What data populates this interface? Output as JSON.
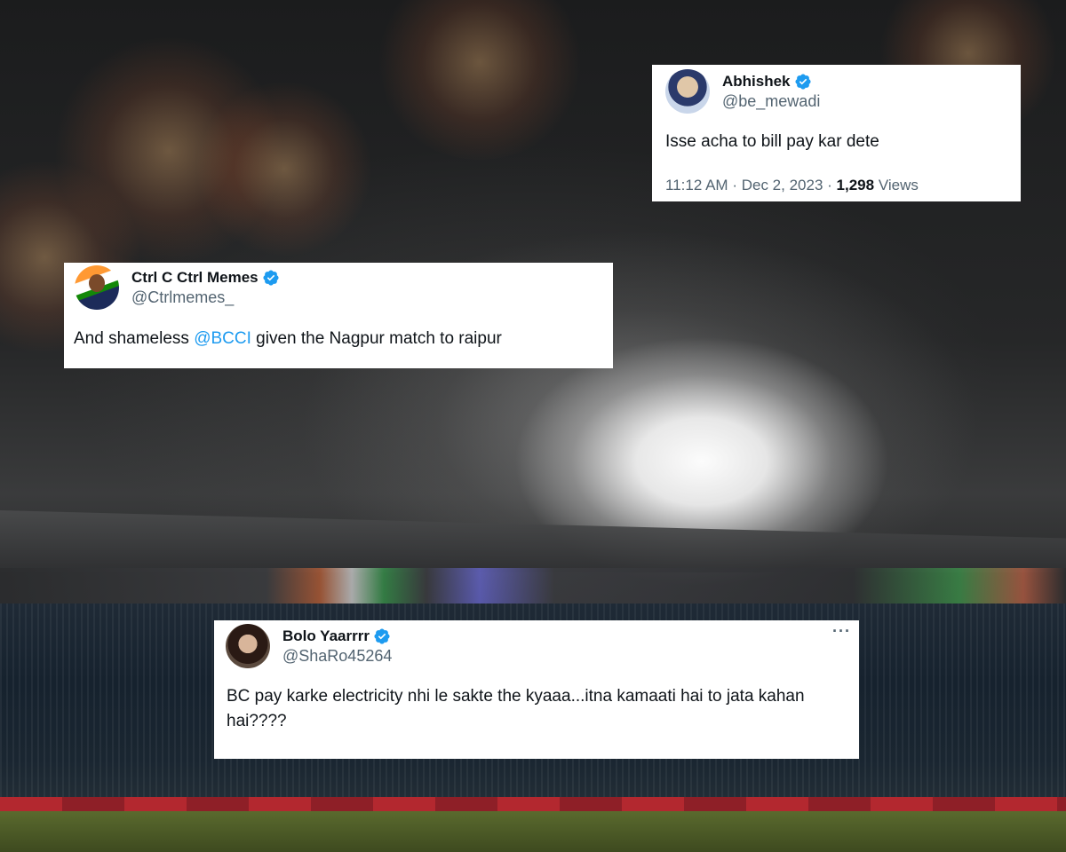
{
  "tweets": [
    {
      "name": "Abhishek",
      "handle": "@be_mewadi",
      "text": "Isse acha to bill pay kar dete",
      "time": "11:12 AM",
      "separator": "·",
      "date": "Dec 2, 2023",
      "views_count": "1,298",
      "views_label": "Views",
      "verified": true
    },
    {
      "name": "Ctrl C Ctrl Memes",
      "handle": "@Ctrlmemes_",
      "text_before": "And shameless ",
      "mention": "@BCCI",
      "text_after": " given the Nagpur match to raipur",
      "verified": true
    },
    {
      "name": "Bolo Yaarrrr",
      "handle": "@ShaRo45264",
      "text": "BC pay karke electricity nhi le sakte the kyaaa...itna kamaati hai to jata kahan hai????",
      "more_icon": "···",
      "verified": true
    }
  ],
  "colors": {
    "verified_badge": "#1d9bf0",
    "mention": "#1d9bf0",
    "secondary_text": "#536471"
  }
}
